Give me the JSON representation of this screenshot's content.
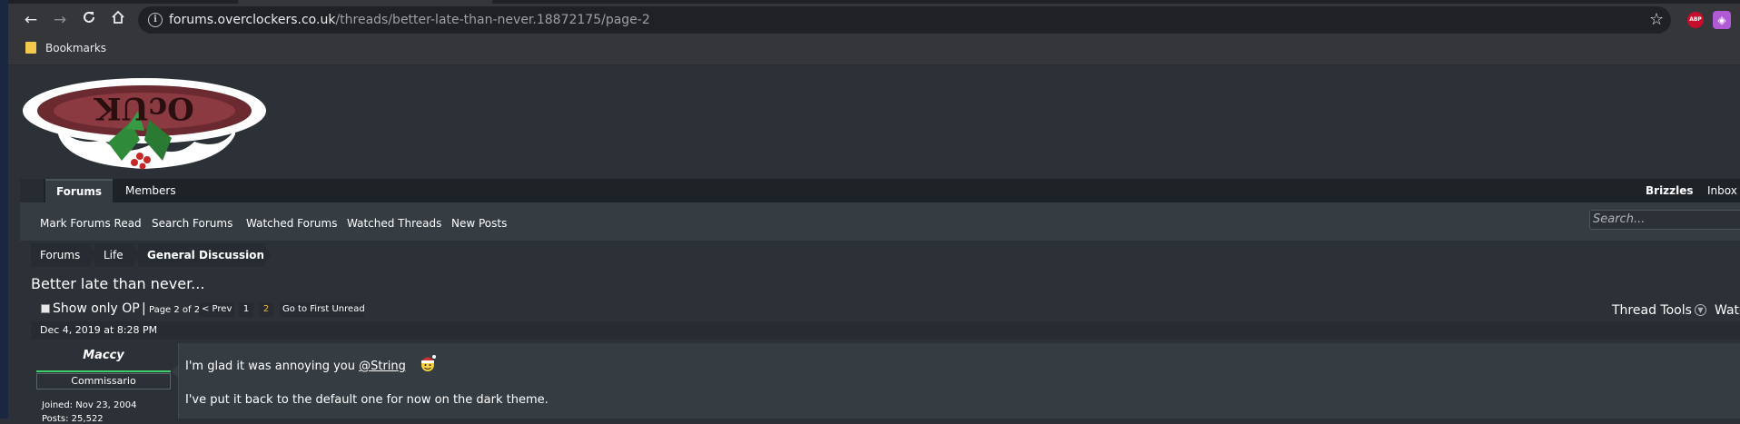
{
  "browser": {
    "nav_icons": [
      "back-arrow-icon",
      "forward-arrow-icon",
      "reload-icon",
      "home-icon"
    ],
    "url_host": "forums.overclockers.co.uk",
    "url_path": "/threads/better-late-than-never.18872175/page-2",
    "extensions": {
      "abp_label": "ABP"
    },
    "bookmarks_label": "Bookmarks"
  },
  "site": {
    "logo_text": "OcUK",
    "nav": {
      "forums": "Forums",
      "members": "Members",
      "username": "Brizzles",
      "inbox": "Inbox"
    },
    "subnav": [
      "Mark Forums Read",
      "Search Forums",
      "Watched Forums",
      "Watched Threads",
      "New Posts"
    ],
    "search_placeholder": "Search...",
    "breadcrumb": [
      "Forums",
      "Life",
      "General Discussion"
    ]
  },
  "thread": {
    "title": "Better late than never...",
    "show_only_op": "Show only OP",
    "separator": "|",
    "page_of": "Page 2 of 2",
    "pager": {
      "prev": "< Prev",
      "page1": "1",
      "page2": "2",
      "first_unread": "Go to First Unread"
    },
    "thread_tools": "Thread Tools",
    "watch_truncated": "Watc"
  },
  "post": {
    "date": "Dec 4, 2019 at 8:28 PM",
    "author": "Maccy",
    "user_title": "Commissario",
    "joined": "Joined: Nov 23, 2004",
    "posts": "Posts: 25,522",
    "line1_prefix": "I'm glad it was annoying you ",
    "mention": "@String",
    "line2": "I've put it back to the default one for now on the dark theme.",
    "emoji": "santa-smiley-icon"
  },
  "colors": {
    "page_bg": "#2b3136",
    "subnav_bg": "#353d43",
    "navbar_bg": "#1e2327",
    "pager_current": "#f2b233",
    "author_bar": "#3ecf6b"
  }
}
